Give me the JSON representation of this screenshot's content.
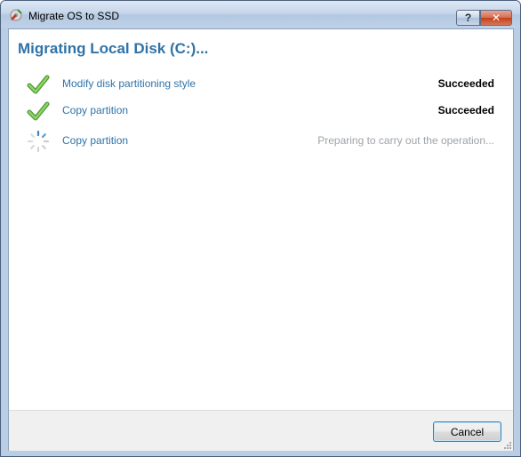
{
  "window": {
    "title": "Migrate OS to SSD",
    "help_glyph": "?",
    "close_glyph": "✕"
  },
  "heading": "Migrating Local Disk (C:)...",
  "operations": [
    {
      "label": "Modify disk partitioning style",
      "status": "Succeeded",
      "state": "done",
      "icon": "check-icon"
    },
    {
      "label": "Copy partition",
      "status": "Succeeded",
      "state": "done",
      "icon": "check-icon"
    },
    {
      "label": "Copy partition",
      "status": "Preparing to carry out the operation...",
      "state": "in-progress",
      "icon": "spinner-icon"
    }
  ],
  "footer": {
    "cancel_label": "Cancel"
  },
  "colors": {
    "accent": "#2f73a8",
    "check": "#6cbf4a",
    "pending_text": "#9ea3a8"
  }
}
